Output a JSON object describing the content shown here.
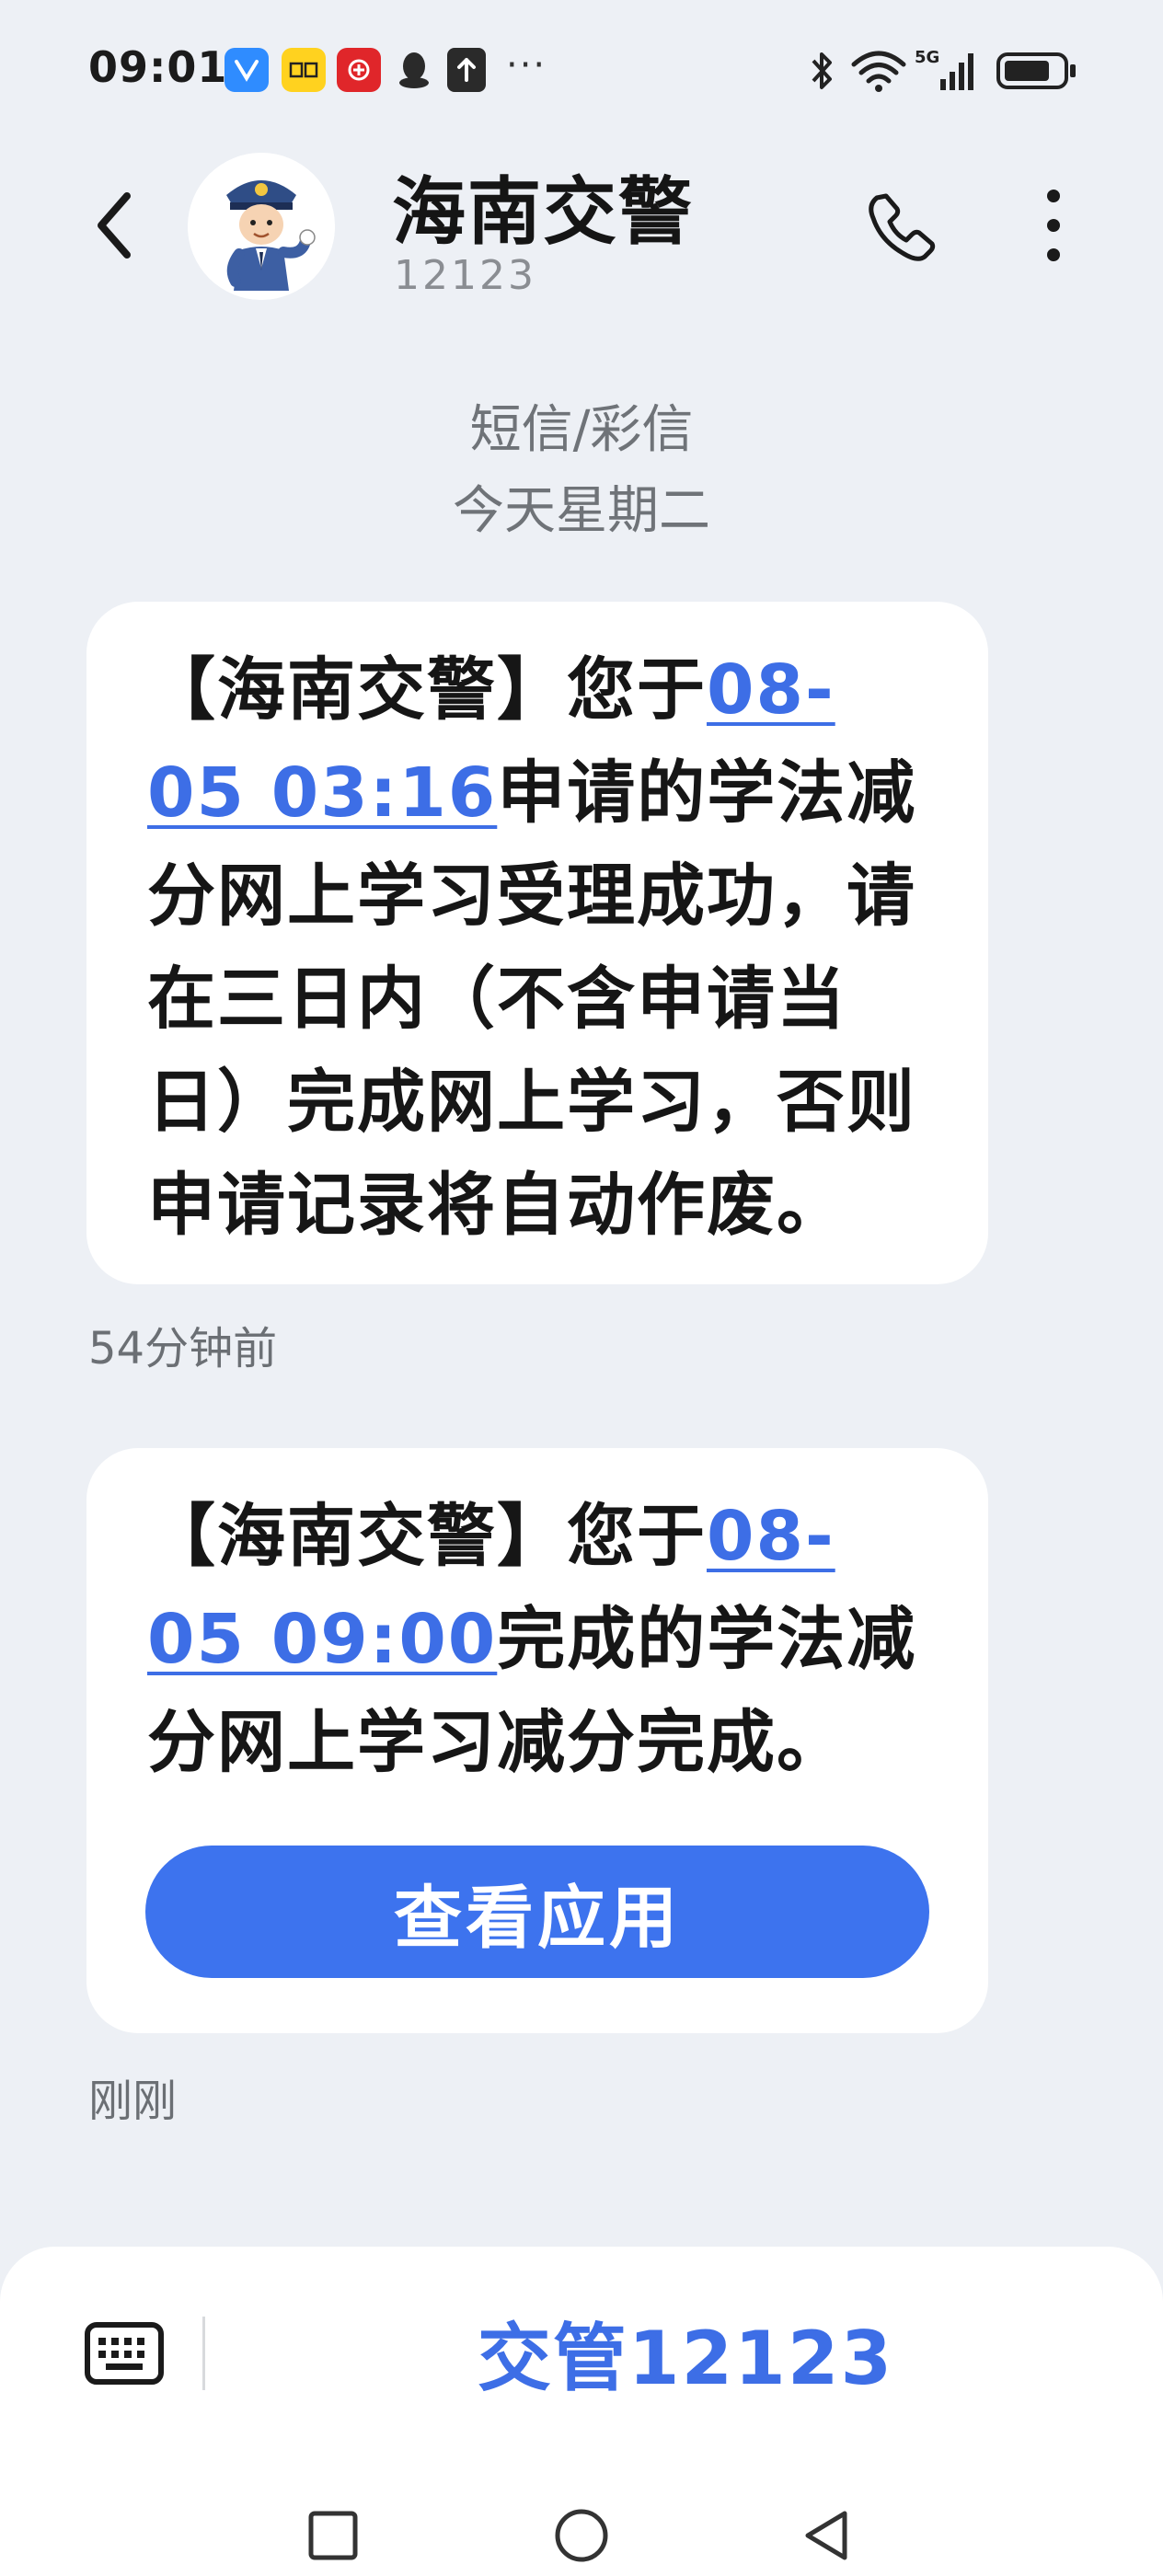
{
  "status_bar": {
    "time": "09:01",
    "more": "···",
    "battery_icon": "battery-icon",
    "signal_label": "5G"
  },
  "header": {
    "contact_name": "海南交警",
    "contact_number": "12123"
  },
  "conversation": {
    "channel": "短信/彩信",
    "date": "今天星期二",
    "messages": [
      {
        "prefix": "【海南交警】您于",
        "link": "08-05 03:16",
        "suffix": "申请的学法减分网上学习受理成功，请在三日内（不含申请当日）完成网上学习，否则申请记录将自动作废。",
        "time": "54分钟前"
      },
      {
        "prefix": "【海南交警】您于",
        "link": "08-05 09:00",
        "suffix": "完成的学法减分网上学习减分完成。",
        "button_label": "查看应用",
        "time": "刚刚"
      }
    ]
  },
  "bottom_menu": {
    "item_label": "交管12123"
  },
  "colors": {
    "accent": "#3d73ee",
    "link": "#3d6ee6",
    "background": "#edf0f5",
    "bubble": "#ffffff"
  }
}
